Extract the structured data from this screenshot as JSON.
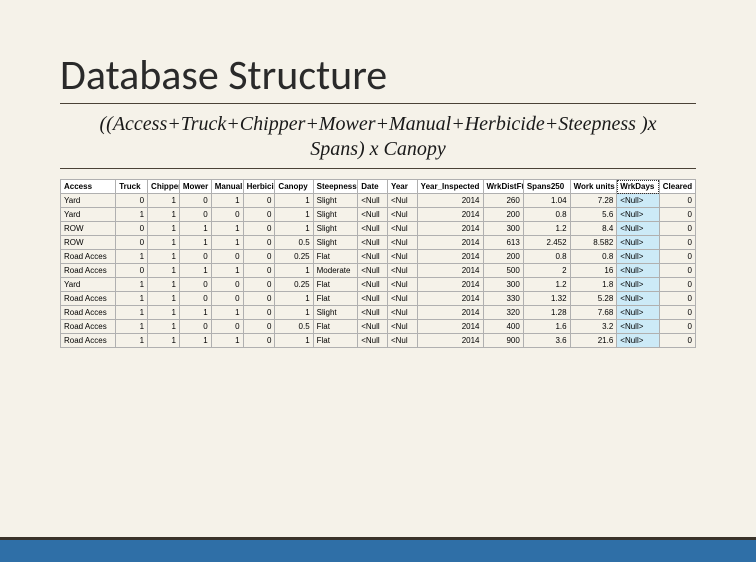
{
  "title": "Database Structure",
  "formula_line1": "((Access+Truck+Chipper+Mower+Manual+Herbicide+Steepness )x",
  "formula_line2": "Spans) x Canopy",
  "headers": {
    "access": "Access",
    "truck": "Truck",
    "chipper": "Chipper",
    "mower": "Mower",
    "manual": "Manual",
    "herbicide": "Herbicide",
    "canopy": "Canopy",
    "steepness": "Steepness",
    "date": "Date",
    "year": "Year",
    "year_inspected": "Year_Inspected",
    "wrkdistft": "WrkDistFt",
    "spans250": "Spans250",
    "workunits": "Work units",
    "wrkdays": "WrkDays",
    "cleared": "Cleared"
  },
  "rows": [
    {
      "access": "Yard",
      "truck": "0",
      "chipper": "1",
      "mower": "0",
      "manual": "1",
      "herbicide": "0",
      "canopy": "1",
      "steepness": "Slight",
      "date": "<Null",
      "year": "<Nul",
      "yi": "2014",
      "wdf": "260",
      "s250": "1.04",
      "wu": "7.28",
      "wd": "<Null>",
      "cl": "0"
    },
    {
      "access": "Yard",
      "truck": "1",
      "chipper": "1",
      "mower": "0",
      "manual": "0",
      "herbicide": "0",
      "canopy": "1",
      "steepness": "Slight",
      "date": "<Null",
      "year": "<Nul",
      "yi": "2014",
      "wdf": "200",
      "s250": "0.8",
      "wu": "5.6",
      "wd": "<Null>",
      "cl": "0"
    },
    {
      "access": "ROW",
      "truck": "0",
      "chipper": "1",
      "mower": "1",
      "manual": "1",
      "herbicide": "0",
      "canopy": "1",
      "steepness": "Slight",
      "date": "<Null",
      "year": "<Nul",
      "yi": "2014",
      "wdf": "300",
      "s250": "1.2",
      "wu": "8.4",
      "wd": "<Null>",
      "cl": "0"
    },
    {
      "access": "ROW",
      "truck": "0",
      "chipper": "1",
      "mower": "1",
      "manual": "1",
      "herbicide": "0",
      "canopy": "0.5",
      "steepness": "Slight",
      "date": "<Null",
      "year": "<Nul",
      "yi": "2014",
      "wdf": "613",
      "s250": "2.452",
      "wu": "8.582",
      "wd": "<Null>",
      "cl": "0"
    },
    {
      "access": "Road Acces",
      "truck": "1",
      "chipper": "1",
      "mower": "0",
      "manual": "0",
      "herbicide": "0",
      "canopy": "0.25",
      "steepness": "Flat",
      "date": "<Null",
      "year": "<Nul",
      "yi": "2014",
      "wdf": "200",
      "s250": "0.8",
      "wu": "0.8",
      "wd": "<Null>",
      "cl": "0"
    },
    {
      "access": "Road Acces",
      "truck": "0",
      "chipper": "1",
      "mower": "1",
      "manual": "1",
      "herbicide": "0",
      "canopy": "1",
      "steepness": "Moderate",
      "date": "<Null",
      "year": "<Nul",
      "yi": "2014",
      "wdf": "500",
      "s250": "2",
      "wu": "16",
      "wd": "<Null>",
      "cl": "0"
    },
    {
      "access": "Yard",
      "truck": "1",
      "chipper": "1",
      "mower": "0",
      "manual": "0",
      "herbicide": "0",
      "canopy": "0.25",
      "steepness": "Flat",
      "date": "<Null",
      "year": "<Nul",
      "yi": "2014",
      "wdf": "300",
      "s250": "1.2",
      "wu": "1.8",
      "wd": "<Null>",
      "cl": "0"
    },
    {
      "access": "Road Acces",
      "truck": "1",
      "chipper": "1",
      "mower": "0",
      "manual": "0",
      "herbicide": "0",
      "canopy": "1",
      "steepness": "Flat",
      "date": "<Null",
      "year": "<Nul",
      "yi": "2014",
      "wdf": "330",
      "s250": "1.32",
      "wu": "5.28",
      "wd": "<Null>",
      "cl": "0"
    },
    {
      "access": "Road Acces",
      "truck": "1",
      "chipper": "1",
      "mower": "1",
      "manual": "1",
      "herbicide": "0",
      "canopy": "1",
      "steepness": "Slight",
      "date": "<Null",
      "year": "<Nul",
      "yi": "2014",
      "wdf": "320",
      "s250": "1.28",
      "wu": "7.68",
      "wd": "<Null>",
      "cl": "0"
    },
    {
      "access": "Road Acces",
      "truck": "1",
      "chipper": "1",
      "mower": "0",
      "manual": "0",
      "herbicide": "0",
      "canopy": "0.5",
      "steepness": "Flat",
      "date": "<Null",
      "year": "<Nul",
      "yi": "2014",
      "wdf": "400",
      "s250": "1.6",
      "wu": "3.2",
      "wd": "<Null>",
      "cl": "0"
    },
    {
      "access": "Road Acces",
      "truck": "1",
      "chipper": "1",
      "mower": "1",
      "manual": "1",
      "herbicide": "0",
      "canopy": "1",
      "steepness": "Flat",
      "date": "<Null",
      "year": "<Nul",
      "yi": "2014",
      "wdf": "900",
      "s250": "3.6",
      "wu": "21.6",
      "wd": "<Null>",
      "cl": "0"
    }
  ]
}
